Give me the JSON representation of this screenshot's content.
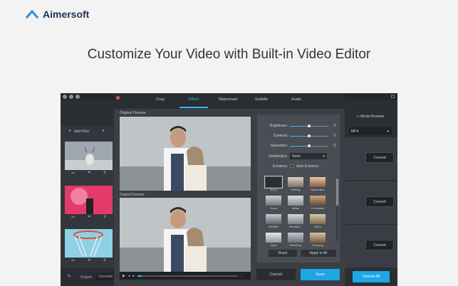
{
  "brand": {
    "name": "Aimersoft",
    "color": "#2a8fd8"
  },
  "headline": "Customize Your Video with Built-in Video Editor",
  "app": {
    "sidebar": {
      "add_files": "Add Files",
      "output_label": "Output:",
      "output_value": "Converte"
    },
    "media_browser": "Media Browser",
    "format": "MP4",
    "convert_label": "Convert",
    "convert_all": "Convert All"
  },
  "editor": {
    "tabs": [
      "Crop",
      "Effect",
      "Watermark",
      "Subtitle",
      "Audio"
    ],
    "active_tab": "Effect",
    "original_preview": "Original Preview",
    "output_preview": "Output Preview",
    "adjustments": [
      {
        "label": "Brightness:",
        "value": "0",
        "level": 0.5
      },
      {
        "label": "Contrast:",
        "value": "0",
        "level": 0.5
      },
      {
        "label": "Saturation:",
        "value": "0",
        "level": 0.5
      }
    ],
    "deinterlace": {
      "label": "Deinterlace:",
      "value": "None"
    },
    "enhance": {
      "label": "Enhance:",
      "option": "Auto Enhance"
    },
    "filters": [
      "None",
      "Holiday",
      "September",
      "Grow",
      "Aibas",
      "Chocolate",
      "SiltFilter",
      "SimpleE...",
      "Retro",
      "Glow",
      "RainDrop",
      "Fuzzying"
    ],
    "selected_filter": "None",
    "reset": "Reset",
    "apply_to_all": "Apply to All",
    "cancel": "Cancel",
    "save": "Save"
  },
  "colors": {
    "accent": "#1fa6e6",
    "dark": "#2b2e33"
  }
}
